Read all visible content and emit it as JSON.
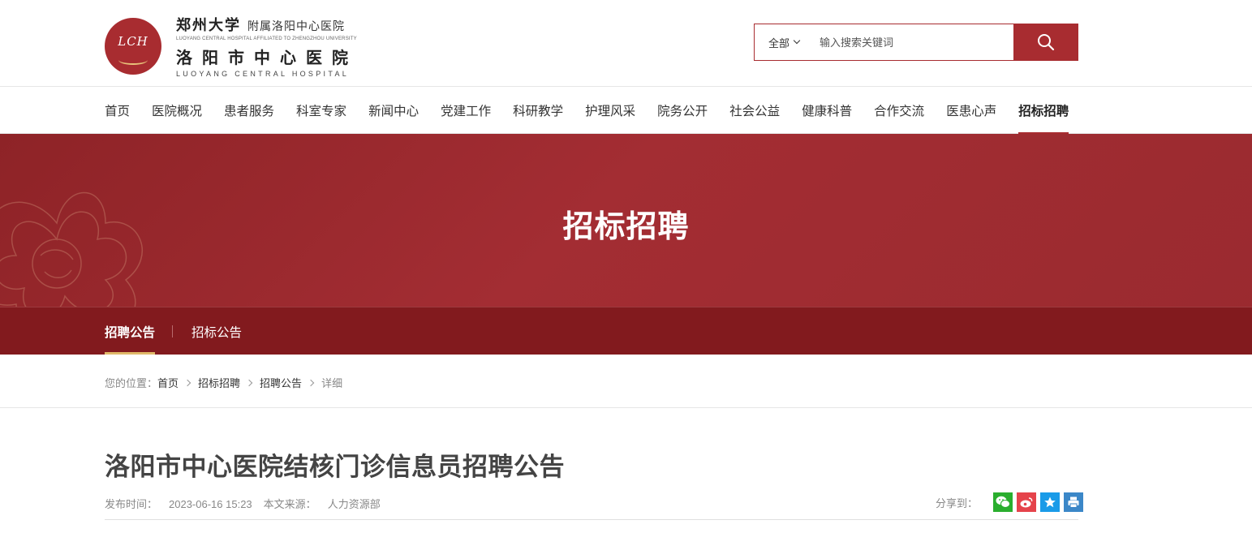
{
  "header": {
    "logo_mark": "LCH",
    "university": "郑州大学",
    "affiliation": "附属洛阳中心医院",
    "affiliation_en": "LUOYANG CENTRAL HOSPITAL AFFILIATED TO ZHENGZHOU UNIVERSITY",
    "hospital_name": "洛阳市中心医院",
    "hospital_name_en": "LUOYANG CENTRAL HOSPITAL",
    "search": {
      "scope": "全部",
      "placeholder": "输入搜索关键词",
      "button_icon": "search-icon"
    }
  },
  "nav": {
    "items": [
      {
        "label": "首页"
      },
      {
        "label": "医院概况"
      },
      {
        "label": "患者服务"
      },
      {
        "label": "科室专家"
      },
      {
        "label": "新闻中心"
      },
      {
        "label": "党建工作"
      },
      {
        "label": "科研教学"
      },
      {
        "label": "护理风采"
      },
      {
        "label": "院务公开"
      },
      {
        "label": "社会公益"
      },
      {
        "label": "健康科普"
      },
      {
        "label": "合作交流"
      },
      {
        "label": "医患心声"
      },
      {
        "label": "招标招聘"
      }
    ],
    "active": "招标招聘"
  },
  "banner": {
    "title": "招标招聘",
    "subnav": [
      {
        "label": "招聘公告"
      },
      {
        "label": "招标公告"
      }
    ],
    "active": "招聘公告"
  },
  "breadcrumb": {
    "prefix": "您的位置：",
    "items": [
      "首页",
      "招标招聘",
      "招聘公告"
    ],
    "current": "详细"
  },
  "article": {
    "title": "洛阳市中心医院结核门诊信息员招聘公告",
    "publish_label": "发布时间：",
    "publish_time": "2023-06-16 15:23",
    "source_label": "本文来源：",
    "source": "人力资源部",
    "share_label": "分享到：",
    "share_icons": [
      "wechat-icon",
      "weibo-icon",
      "favorite-icon",
      "print-icon"
    ]
  },
  "colors": {
    "brand_red": "#a82c30",
    "subnav_red": "#821a1e",
    "gold": "#e0b96a",
    "wechat": "#2aae2e",
    "weibo": "#e5434b",
    "favorite": "#1a9be8",
    "print": "#3b87c8"
  }
}
